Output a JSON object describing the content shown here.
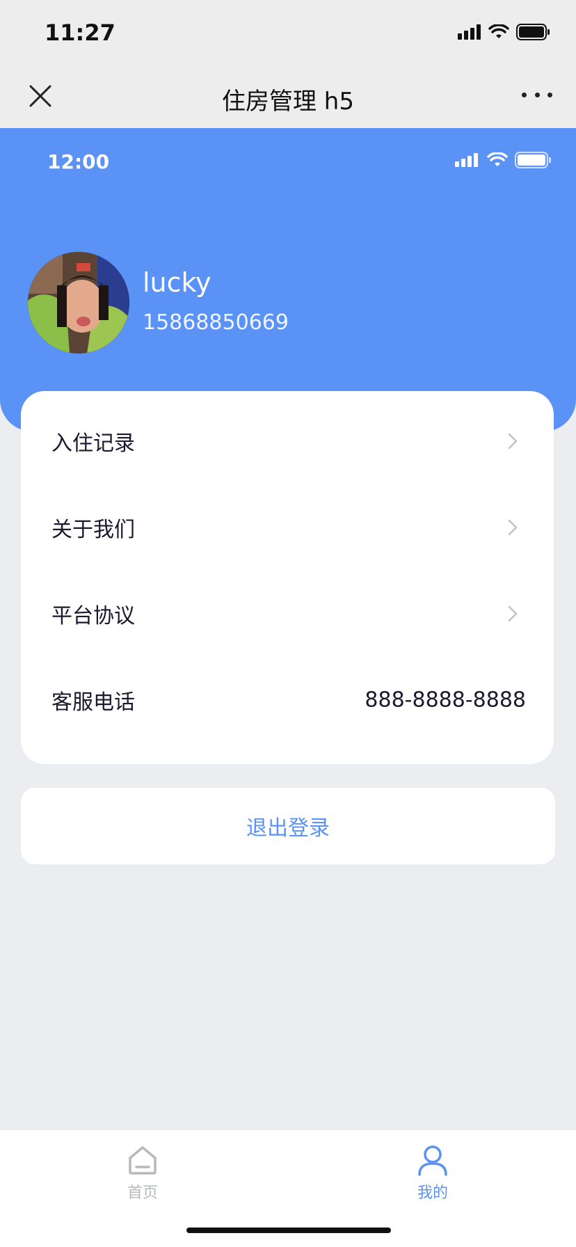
{
  "system_status": {
    "time": "11:27"
  },
  "navbar": {
    "title": "住房管理 h5"
  },
  "inner_status": {
    "time": "12:00"
  },
  "profile": {
    "name": "lucky",
    "phone": "15868850669"
  },
  "menu": {
    "items": [
      {
        "label": "入住记录"
      },
      {
        "label": "关于我们"
      },
      {
        "label": "平台协议"
      }
    ],
    "hotline": {
      "label": "客服电话",
      "value": "888-8888-8888"
    }
  },
  "logout_label": "退出登录",
  "tabbar": {
    "home_label": "首页",
    "mine_label": "我的"
  },
  "colors": {
    "accent": "#5b92f5",
    "background": "#ecedf0",
    "inactive_tab": "#b5b8bd"
  }
}
